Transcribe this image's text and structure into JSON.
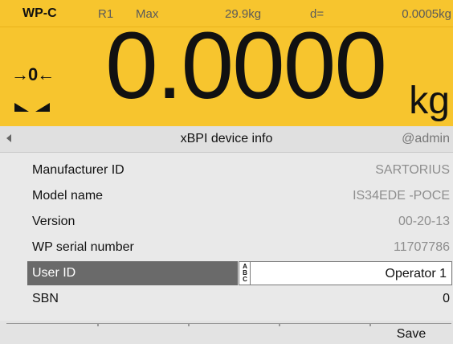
{
  "status": {
    "platform": "WP-C",
    "range": "R1",
    "max_label": "Max",
    "capacity": "29.9kg",
    "d_label": "d=",
    "d_value": "0.0005kg"
  },
  "weight": {
    "value": "0.0000",
    "unit": "kg",
    "zero_indicator": "→0←"
  },
  "titlebar": {
    "title": "xBPI device info",
    "user": "@admin"
  },
  "rows": [
    {
      "label": "Manufacturer ID",
      "value": "SARTORIUS"
    },
    {
      "label": "Model name",
      "value": "IS34EDE -POCE"
    },
    {
      "label": "Version",
      "value": "00-20-13"
    },
    {
      "label": "WP serial number",
      "value": "11707786"
    },
    {
      "label": "User ID",
      "value": "Operator 1",
      "input_mode": "ABC"
    },
    {
      "label": "SBN",
      "value": "0"
    }
  ],
  "softkeys": [
    "",
    "",
    "",
    "",
    "Save"
  ],
  "colors": {
    "accent_yellow": "#f7c52e",
    "selected_row": "#6a6a6a"
  }
}
